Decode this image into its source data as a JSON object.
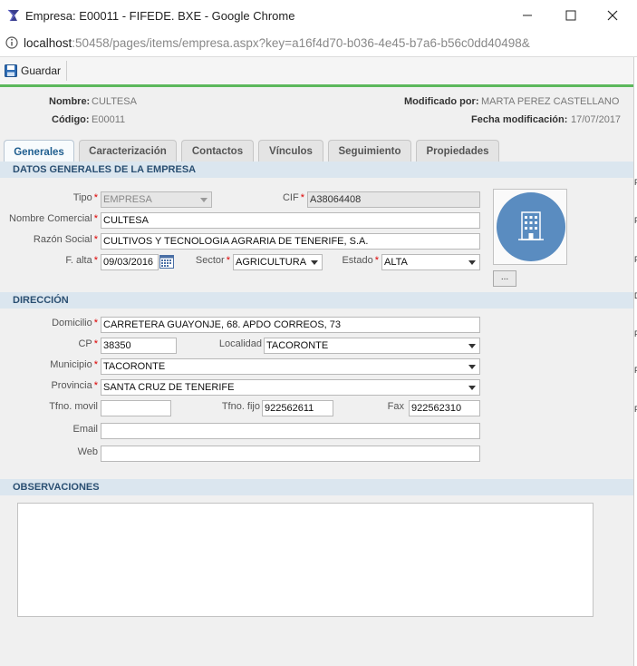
{
  "window": {
    "title": "Empresa: E00011 - FIFEDE. BXE - Google Chrome"
  },
  "address": {
    "host": "localhost",
    "path": ":50458/pages/items/empresa.aspx?key=a16f4d70-b036-4e45-b7a6-b56c0dd40498&"
  },
  "toolbar": {
    "save_label": "Guardar"
  },
  "header": {
    "nombre_label": "Nombre:",
    "nombre_value": "CULTESA",
    "codigo_label": "Código:",
    "codigo_value": "E00011",
    "modificado_label": "Modificado por:",
    "modificado_value": "MARTA PEREZ CASTELLANO",
    "fecha_label": "Fecha modificación:",
    "fecha_value": "17/07/2017"
  },
  "tabs": [
    {
      "label": "Generales"
    },
    {
      "label": "Caracterización"
    },
    {
      "label": "Contactos"
    },
    {
      "label": "Vínculos"
    },
    {
      "label": "Seguimiento"
    },
    {
      "label": "Propiedades"
    }
  ],
  "sections": {
    "datos": "DATOS GENERALES DE LA EMPRESA",
    "direccion": "DIRECCIÓN",
    "observaciones": "OBSERVACIONES"
  },
  "fields": {
    "tipo": {
      "label": "Tipo",
      "value": "EMPRESA"
    },
    "cif": {
      "label": "CIF",
      "value": "A38064408"
    },
    "nombre_comercial": {
      "label": "Nombre Comercial",
      "value": "CULTESA"
    },
    "razon_social": {
      "label": "Razón Social",
      "value": "CULTIVOS Y TECNOLOGIA AGRARIA DE TENERIFE, S.A."
    },
    "f_alta": {
      "label": "F. alta",
      "value": "09/03/2016"
    },
    "sector": {
      "label": "Sector",
      "value": "AGRICULTURA"
    },
    "estado": {
      "label": "Estado",
      "value": "ALTA"
    },
    "domicilio": {
      "label": "Domicilio",
      "value": "CARRETERA GUAYONJE, 68. APDO CORREOS, 73"
    },
    "cp": {
      "label": "CP",
      "value": "38350"
    },
    "localidad": {
      "label": "Localidad",
      "value": "TACORONTE"
    },
    "municipio": {
      "label": "Municipio",
      "value": "TACORONTE"
    },
    "provincia": {
      "label": "Provincia",
      "value": "SANTA CRUZ DE TENERIFE"
    },
    "tfno_movil": {
      "label": "Tfno. movil",
      "value": ""
    },
    "tfno_fijo": {
      "label": "Tfno. fijo",
      "value": "922562611"
    },
    "fax": {
      "label": "Fax",
      "value": "922562310"
    },
    "email": {
      "label": "Email",
      "value": ""
    },
    "web": {
      "label": "Web",
      "value": ""
    },
    "observaciones": {
      "value": ""
    }
  },
  "required_mark": "*",
  "photo_button_label": "...",
  "icons": {
    "app": "fifede-logo-icon",
    "info": "info-icon",
    "save": "save-floppy-icon",
    "calendar": "calendar-icon",
    "company": "building-icon",
    "minimize": "minimize-icon",
    "maximize": "maximize-icon",
    "close": "close-icon"
  },
  "colors": {
    "accent_green": "#5cb85c",
    "section_bg": "#dbe6ef",
    "section_text": "#2a4f72",
    "photo_circle": "#5a8cc0",
    "required": "#dd0000"
  }
}
